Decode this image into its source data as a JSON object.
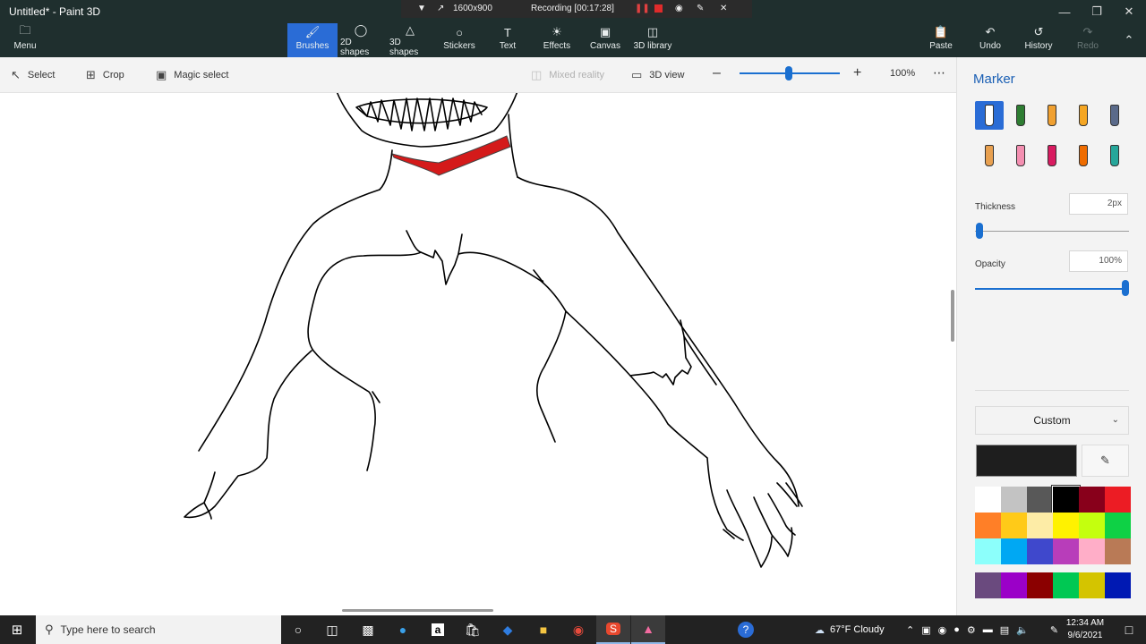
{
  "window": {
    "title": "Untitled* - Paint 3D"
  },
  "recorder": {
    "resolution": "1600x900",
    "status": "Recording [00:17:28]"
  },
  "ribbon": {
    "menu": "Menu",
    "tools": [
      {
        "label": "Brushes",
        "icon": "brush-icon",
        "active": true
      },
      {
        "label": "2D shapes",
        "icon": "2d-shapes-icon"
      },
      {
        "label": "3D shapes",
        "icon": "3d-shapes-icon"
      },
      {
        "label": "Stickers",
        "icon": "stickers-icon"
      },
      {
        "label": "Text",
        "icon": "text-icon"
      },
      {
        "label": "Effects",
        "icon": "effects-icon"
      },
      {
        "label": "Canvas",
        "icon": "canvas-icon"
      },
      {
        "label": "3D library",
        "icon": "3d-library-icon"
      }
    ],
    "paste": "Paste",
    "undo": "Undo",
    "history": "History",
    "redo": "Redo"
  },
  "toolbar": {
    "select": "Select",
    "crop": "Crop",
    "magic_select": "Magic select",
    "mixed_reality": "Mixed reality",
    "view_3d": "3D view",
    "zoom_value": "100%",
    "zoom_level": 0.5
  },
  "panel": {
    "title": "Marker",
    "thickness_label": "Thickness",
    "thickness_value": "2px",
    "thickness_level": 0.02,
    "opacity_label": "Opacity",
    "opacity_value": "100%",
    "opacity_level": 1.0,
    "palette_select": "Custom",
    "brushes": [
      "marker",
      "calligraphy-pen",
      "oil-brush",
      "watercolor",
      "pixel-pen",
      "pencil",
      "eraser",
      "crayon",
      "spray-can",
      "fill"
    ],
    "current_color": "#1e1e1e",
    "swatches": [
      "#ffffff",
      "#c3c3c3",
      "#585858",
      "#000000",
      "#88001b",
      "#ec1c24",
      "#ff7f27",
      "#ffca18",
      "#fdeca6",
      "#fff200",
      "#c4ff0e",
      "#0ed145",
      "#8cfffb",
      "#00a8f3",
      "#3f48cc",
      "#b83dba",
      "#ffaec8",
      "#b97a56"
    ],
    "custom_swatches": [
      "#6a4a7e",
      "#9b00c8",
      "#8b0000",
      "#00c853",
      "#d4c400",
      "#0019b3"
    ]
  },
  "taskbar": {
    "search_placeholder": "Type here to search",
    "weather": "67°F  Cloudy",
    "time": "12:34 AM",
    "date": "9/6/2021"
  }
}
